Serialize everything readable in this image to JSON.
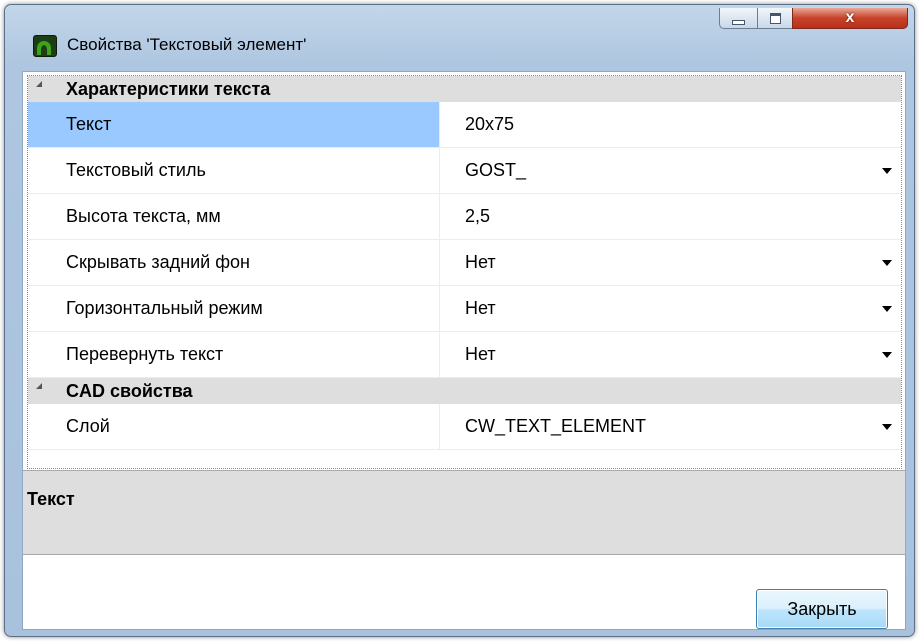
{
  "window": {
    "title": "Свойства 'Текстовый элемент'",
    "minimize_label": "",
    "maximize_label": "",
    "close_label": "x"
  },
  "grid": {
    "categories": [
      {
        "label": "Характеристики текста",
        "properties": [
          {
            "name": "Текст",
            "value": "20x75",
            "dropdown": false,
            "selected": true
          },
          {
            "name": "Текстовый стиль",
            "value": "GOST_",
            "dropdown": true,
            "selected": false
          },
          {
            "name": "Высота текста, мм",
            "value": "2,5",
            "dropdown": false,
            "selected": false
          },
          {
            "name": "Скрывать задний фон",
            "value": "Нет",
            "dropdown": true,
            "selected": false
          },
          {
            "name": "Горизонтальный режим",
            "value": "Нет",
            "dropdown": true,
            "selected": false
          },
          {
            "name": "Перевернуть текст",
            "value": "Нет",
            "dropdown": true,
            "selected": false
          }
        ]
      },
      {
        "label": "CAD свойства",
        "properties": [
          {
            "name": "Слой",
            "value": "CW_TEXT_ELEMENT",
            "dropdown": true,
            "selected": false
          }
        ]
      }
    ]
  },
  "help": {
    "title": "Текст"
  },
  "footer": {
    "close_button_label": "Закрыть"
  },
  "colors": {
    "selection": "#99c9ff",
    "category_background": "#dedede"
  }
}
